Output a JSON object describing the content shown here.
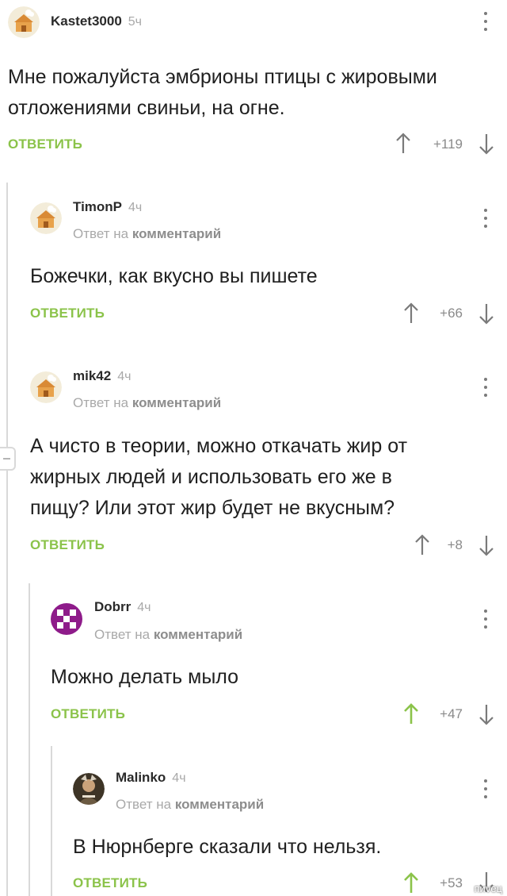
{
  "common": {
    "reply_label": "ОТВЕТИТЬ",
    "reply_to_prefix": "Ответ на",
    "reply_to_target": "комментарий"
  },
  "comments": [
    {
      "author": "Kastet3000",
      "time": "5ч",
      "avatar": "default-house-avatar",
      "lines": [
        "Мне пожалуйста эмбрионы птицы с жировыми",
        "отложениями свиньи, на огне."
      ],
      "rating": "+119",
      "upvoted": false
    },
    {
      "author": "TimonP",
      "time": "4ч",
      "avatar": "default-house-avatar",
      "lines": [
        "Божечки, как вкусно вы пишете"
      ],
      "rating": "+66",
      "upvoted": false
    },
    {
      "author": "mik42",
      "time": "4ч",
      "avatar": "default-house-avatar",
      "lines": [
        "А чисто в теории, можно откачать жир от",
        "жирных людей и использовать его же в",
        "пищу? Или этот жир будет не вкусным?"
      ],
      "rating": "+8",
      "upvoted": false
    },
    {
      "author": "Dobrr",
      "time": "4ч",
      "avatar": "purple-pixel-avatar",
      "lines": [
        "Можно делать мыло"
      ],
      "rating": "+47",
      "upvoted": true
    },
    {
      "author": "Malinko",
      "time": "4ч",
      "avatar": "photo-avatar",
      "lines": [
        "В Нюрнберге сказали что нельзя."
      ],
      "rating": "+53",
      "upvoted": true
    }
  ],
  "colors": {
    "accent_green": "#8bc34a",
    "thread_line": "#d9d9d9",
    "arrow_default": "#7a7a7a"
  },
  "watermark": "пиvец"
}
